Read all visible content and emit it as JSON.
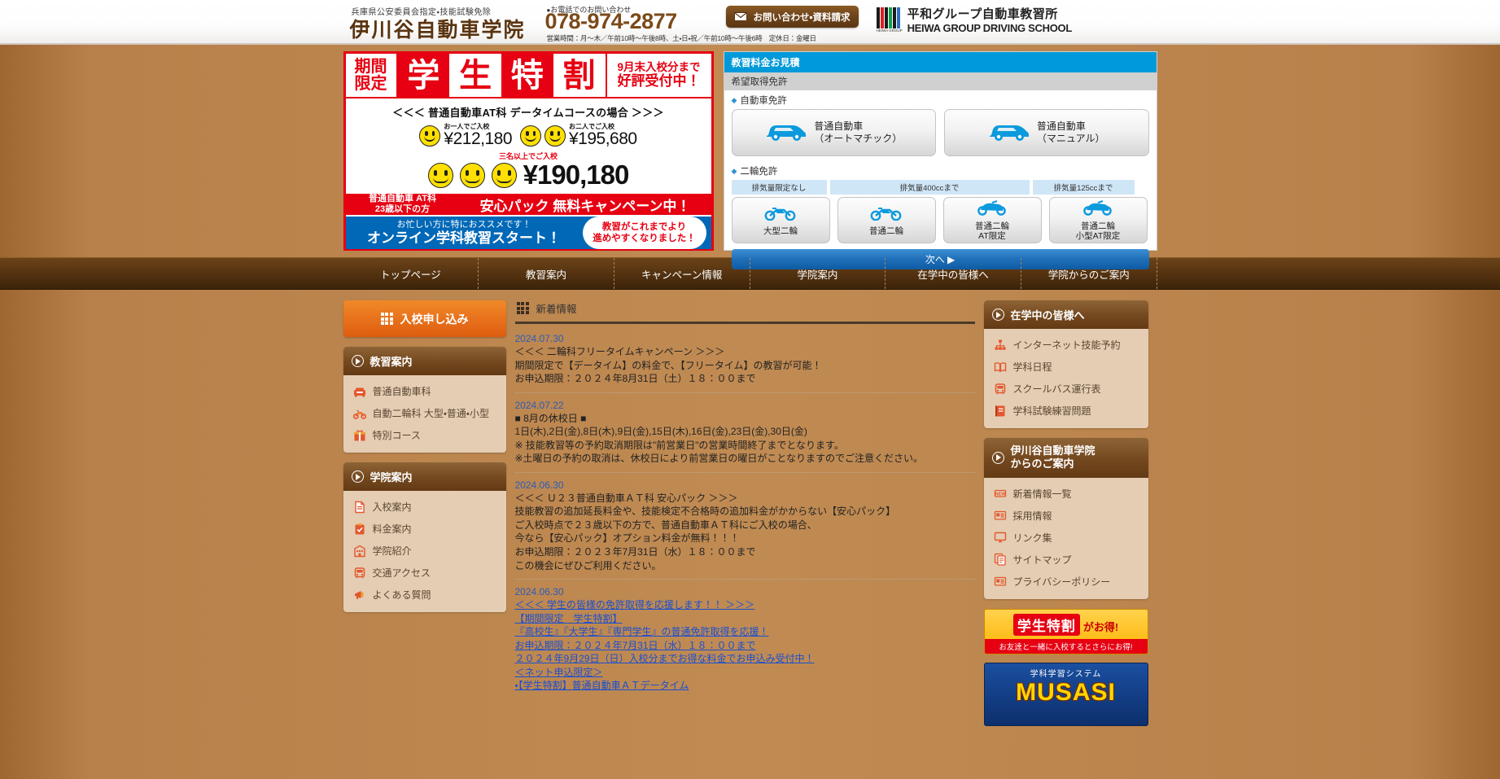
{
  "header": {
    "school_sub": "兵庫県公安委員会指定・技能試験免除",
    "school_name": "伊川谷自動車学院",
    "tel_label": "お電話でのお問い合わせ",
    "tel_number": "078-974-2877",
    "tel_hours": "営業時間：月〜木／午前10時〜午後8時、土・日・祝／午前10時〜午後6時　定休日：金曜日",
    "contact_button": "お問い合わせ・資料請求",
    "group_name_jp": "平和グループ自動車教習所",
    "group_name_en": "HEIWA GROUP DRIVING SCHOOL",
    "group_logo_caption": "HEIWA GROUP"
  },
  "promo": {
    "limited_line1": "期間",
    "limited_line2": "限定",
    "big_chars": [
      "学",
      "生",
      "特",
      "割"
    ],
    "right_line1": "9月末入校分まで",
    "right_line2": "好評受付中！",
    "course_line": "＜＜＜ 普通自動車AT科 データイムコースの場合 ＞＞＞",
    "price_one_caption": "お一人でご入校",
    "price_one_amount": "¥212,180",
    "price_two_caption": "お二人でご入校",
    "price_two_amount": "¥195,680",
    "price_three_caption": "三名以上でご入校",
    "price_three_amount": "¥190,180",
    "anshin_left_line1": "普通自動車 AT科",
    "anshin_left_line2": "23歳以下の方",
    "anshin_right": "安心パック 無料キャンペーン中！",
    "online_line1": "お忙しい方に特におススメです！",
    "online_line2": "オンライン学科教習スタート！",
    "bubble_line1": "教習がこれまでより",
    "bubble_line2": "進めやすくなりました！"
  },
  "estimate": {
    "head": "教習料金お見積",
    "sub": "希望取得免許",
    "car_group_label": "自動車免許",
    "car_options": [
      {
        "line1": "普通自動車",
        "line2": "（オートマチック）",
        "icon": "car-icon"
      },
      {
        "line1": "普通自動車",
        "line2": "（マニュアル）",
        "icon": "car-icon"
      }
    ],
    "moto_group_label": "二輪免許",
    "moto_bars": [
      "排気量限定なし",
      "排気量400ccまで",
      "排気量125ccまで"
    ],
    "moto_options": [
      {
        "line1": "大型二輪",
        "line2": "",
        "icon": "motorcycle-icon"
      },
      {
        "line1": "普通二輪",
        "line2": "",
        "icon": "motorcycle-icon"
      },
      {
        "line1": "普通二輪",
        "line2": "AT限定",
        "icon": "scooter-icon"
      },
      {
        "line1": "普通二輪",
        "line2": "小型AT限定",
        "icon": "scooter-icon"
      }
    ],
    "next_button": "次へ ▶"
  },
  "nav": [
    "トップページ",
    "教習案内",
    "キャンペーン情報",
    "学院案内",
    "在学中の皆様へ",
    "学院からのご案内"
  ],
  "sidebar_left": {
    "apply_button": "入校申し込み",
    "boxes": [
      {
        "title": "教習案内",
        "items": [
          {
            "label": "普通自動車科",
            "icon": "car-front-icon",
            "color": "#e4572e"
          },
          {
            "label": "自動二輪科 大型・普通・小型",
            "icon": "motorcycle-icon",
            "color": "#e4572e"
          },
          {
            "label": "特別コース",
            "icon": "gift-icon",
            "color": "#e4572e"
          }
        ]
      },
      {
        "title": "学院案内",
        "items": [
          {
            "label": "入校案内",
            "icon": "document-icon",
            "color": "#e4572e"
          },
          {
            "label": "料金案内",
            "icon": "clipboard-check-icon",
            "color": "#e4572e"
          },
          {
            "label": "学院紹介",
            "icon": "building-icon",
            "color": "#e4572e"
          },
          {
            "label": "交通アクセス",
            "icon": "bus-icon",
            "color": "#e4572e"
          },
          {
            "label": "よくある質問",
            "icon": "megaphone-icon",
            "color": "#e4572e"
          }
        ]
      }
    ]
  },
  "main": {
    "section_title": "新着情報",
    "news": [
      {
        "date": "2024.07.30",
        "link": false,
        "lines": [
          "＜＜＜ 二輪科フリータイムキャンペーン ＞＞＞",
          "期間限定で【データイム】の料金で、【フリータイム】の教習が可能！",
          "お申込期限：２０２４年8月31日（土）１８：００まで"
        ]
      },
      {
        "date": "2024.07.22",
        "link": false,
        "lines": [
          "■ 8月の休校日 ■",
          "1日(木),2日(金),8日(木),9日(金),15日(木),16日(金),23日(金),30日(金)",
          "※ 技能教習等の予約取消期限は\"前営業日\"の営業時間終了までとなります。",
          "※土曜日の予約の取消は、休校日により前営業日の曜日がことなりますのでご注意ください。"
        ]
      },
      {
        "date": "2024.06.30",
        "link": false,
        "lines": [
          "＜＜＜ Ｕ２３普通自動車ＡＴ科 安心パック ＞＞＞",
          "技能教習の追加延長料金や、技能検定不合格時の追加料金がかからない【安心パック】",
          "ご入校時点で２３歳以下の方で、普通自動車ＡＴ科にご入校の場合、",
          "今なら【安心パック】オプション料金が無料！！！",
          "お申込期限：２０２３年7月31日（水）１８：００まで",
          "この機会にぜひご利用ください。"
        ]
      },
      {
        "date": "2024.06.30",
        "link": true,
        "lines": [
          "＜＜＜ 学生の皆様の免許取得を応援します！！ ＞＞＞",
          "【期間限定　学生特割】",
          "『高校生』『大学生』『専門学生』の普通免許取得を応援！",
          "お申込期限：２０２４年7月31日（水）１８：００まで",
          "２０２４年9月29日（日）入校分までお得な料金でお申込み受付中！",
          "＜ネット申込限定＞",
          "・【学生特割】普通自動車ＡＴデータイム"
        ]
      }
    ]
  },
  "sidebar_right": {
    "boxes": [
      {
        "title": "在学中の皆様へ",
        "title2": "",
        "items": [
          {
            "label": "インターネット技能予約",
            "icon": "network-icon"
          },
          {
            "label": "学科日程",
            "icon": "book-icon"
          },
          {
            "label": "スクールバス運行表",
            "icon": "bus-icon"
          },
          {
            "label": "学科試験練習問題",
            "icon": "notebook-icon"
          }
        ]
      },
      {
        "title": "伊川谷自動車学院",
        "title2": "からのご案内",
        "items": [
          {
            "label": "新着情報一覧",
            "icon": "new-badge-icon"
          },
          {
            "label": "採用情報",
            "icon": "id-card-icon"
          },
          {
            "label": "リンク集",
            "icon": "monitor-icon"
          },
          {
            "label": "サイトマップ",
            "icon": "pages-icon"
          },
          {
            "label": "プライバシーポリシー",
            "icon": "id-card-icon"
          }
        ]
      }
    ],
    "banner_student": {
      "word1": "学生特割",
      "word2": "がお得!",
      "sub": "お友達と一緒に入校するとさらにお得!"
    },
    "banner_musasi": {
      "top": "学科学習システム",
      "title": "MUSASI"
    }
  },
  "colors": {
    "brand_brown": "#633a15",
    "accent_orange": "#e4572e",
    "promo_red": "#e60012",
    "estimate_blue": "#0099d9",
    "link_blue": "#1a4fd0"
  }
}
